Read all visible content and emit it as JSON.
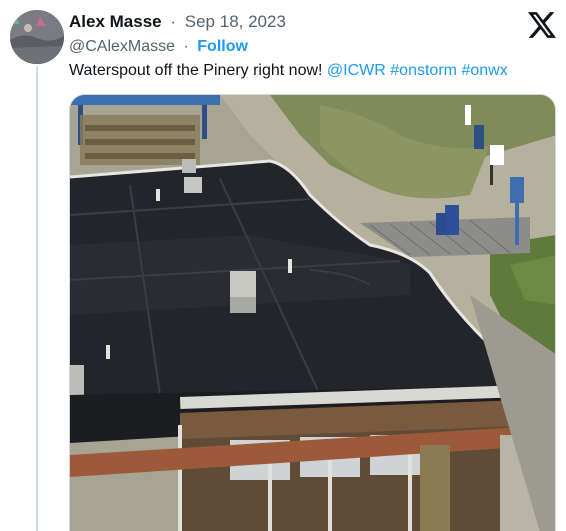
{
  "author": {
    "name": "Alex Masse",
    "separator": "·",
    "date": "Sep 18, 2023",
    "handle": "@CAlexMasse",
    "follow_label": "Follow",
    "avatar_icon": "profile-photo-icon"
  },
  "brand_icon": "x-logo-icon",
  "tweet": {
    "text": "Waterspout off the Pinery right now!",
    "mention": "@ICWR",
    "hashtags": [
      "#onstorm",
      "#onwx"
    ]
  },
  "colors": {
    "link": "#1d9bf0",
    "secondary_text": "#536471",
    "primary_text": "#0f1419"
  },
  "media": {
    "type": "photo",
    "subject": "rooftop-beach-scene"
  }
}
